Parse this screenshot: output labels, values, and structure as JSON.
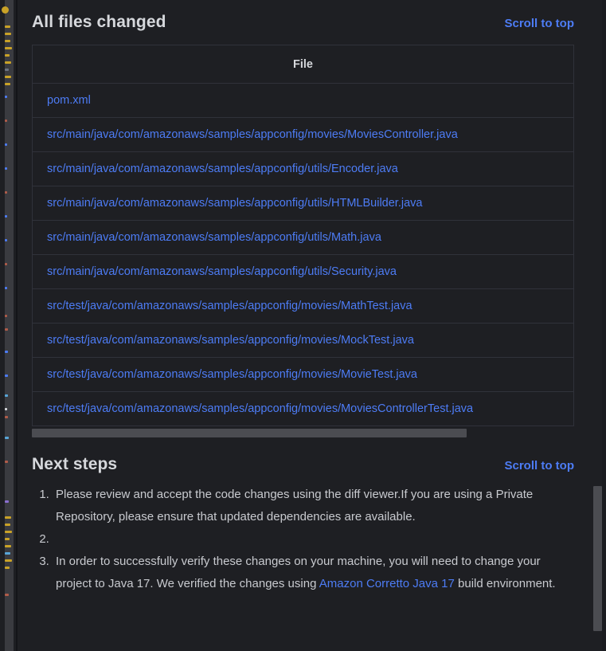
{
  "theme": {
    "background": "#1e1f23",
    "panel_background": "#1e1f23",
    "border": "#30323a",
    "text": "#d6d8dc",
    "body_text": "#c8cacf",
    "link": "#4d7cf5",
    "accent_indicator": "#3b7ff0",
    "scrollbar_thumb": "#4b4c51"
  },
  "files_section": {
    "title": "All files changed",
    "scroll_top_label": "Scroll to top",
    "table": {
      "columns": [
        "File"
      ],
      "rows": [
        "pom.xml",
        "src/main/java/com/amazonaws/samples/appconfig/movies/MoviesController.java",
        "src/main/java/com/amazonaws/samples/appconfig/utils/Encoder.java",
        "src/main/java/com/amazonaws/samples/appconfig/utils/HTMLBuilder.java",
        "src/main/java/com/amazonaws/samples/appconfig/utils/Math.java",
        "src/main/java/com/amazonaws/samples/appconfig/utils/Security.java",
        "src/test/java/com/amazonaws/samples/appconfig/movies/MathTest.java",
        "src/test/java/com/amazonaws/samples/appconfig/movies/MockTest.java",
        "src/test/java/com/amazonaws/samples/appconfig/movies/MovieTest.java",
        "src/test/java/com/amazonaws/samples/appconfig/movies/MoviesControllerTest.java"
      ]
    }
  },
  "next_steps_section": {
    "title": "Next steps",
    "scroll_top_label": "Scroll to top",
    "steps": [
      {
        "number": "1",
        "text_before": "Please review and accept the code changes using the diff viewer.If you are using a Private Repository, please ensure that updated dependencies are available.",
        "link": "",
        "text_after": ""
      },
      {
        "number": "2",
        "text_before": "",
        "link": "",
        "text_after": ""
      },
      {
        "number": "3",
        "text_before": "In order to successfully verify these changes on your machine, you will need to change your project to Java 17. We verified the changes using ",
        "link": "Amazon Corretto Java 17",
        "text_after": " build environment."
      }
    ]
  }
}
